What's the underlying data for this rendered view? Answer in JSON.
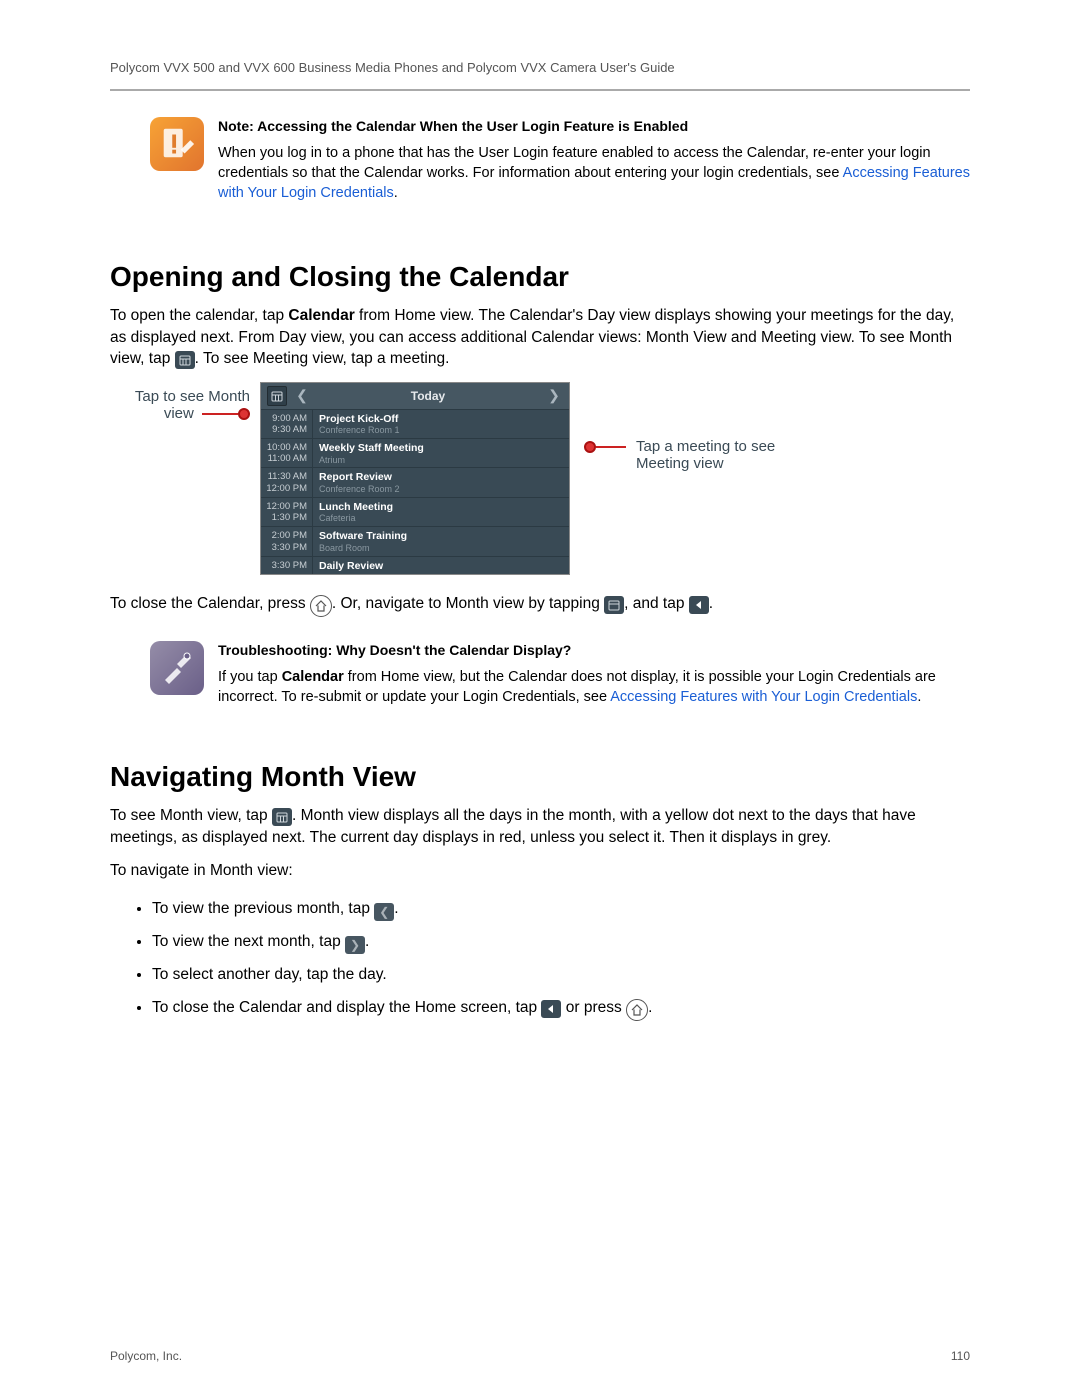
{
  "header": {
    "title": "Polycom VVX 500 and VVX 600 Business Media Phones and Polycom VVX Camera User's Guide"
  },
  "note": {
    "title": "Note: Accessing the Calendar When the User Login Feature is Enabled",
    "body_pre": "When you log in to a phone that has the User Login feature enabled to access the Calendar, re-enter your login credentials so that the Calendar works. For information about entering your login credentials, see ",
    "link": "Accessing Features with Your Login Credentials",
    "body_post": "."
  },
  "section1": {
    "heading": "Opening and Closing the Calendar",
    "p1_pre": "To open the calendar, tap ",
    "p1_bold": "Calendar",
    "p1_mid": " from Home view. The Calendar's Day view displays showing your meetings for the day, as displayed next. From Day view, you can access additional Calendar views: Month View and Meeting view. To see Month view, tap ",
    "p1_post": ". To see Meeting view, tap a meeting.",
    "close_pre": "To close the Calendar, press ",
    "close_mid": ". Or, navigate to Month view by tapping ",
    "close_between": ", and tap ",
    "close_post": "."
  },
  "callouts": {
    "left": "Tap to see Month view",
    "right": "Tap a meeting to see Meeting view"
  },
  "shot": {
    "today": "Today",
    "events": [
      {
        "start": "9:00 AM",
        "end": "9:30 AM",
        "title": "Project Kick-Off",
        "loc": "Conference Room 1"
      },
      {
        "start": "10:00 AM",
        "end": "11:00 AM",
        "title": "Weekly Staff Meeting",
        "loc": "Atrium"
      },
      {
        "start": "11:30 AM",
        "end": "12:00 PM",
        "title": "Report Review",
        "loc": "Conference Room 2"
      },
      {
        "start": "12:00 PM",
        "end": "1:30 PM",
        "title": "Lunch Meeting",
        "loc": "Cafeteria"
      },
      {
        "start": "2:00 PM",
        "end": "3:30 PM",
        "title": "Software Training",
        "loc": "Board Room"
      },
      {
        "start": "3:30 PM",
        "end": "",
        "title": "Daily Review",
        "loc": ""
      }
    ]
  },
  "trouble": {
    "title": "Troubleshooting: Why Doesn't the Calendar Display?",
    "pre": "If you tap ",
    "bold": "Calendar",
    "mid": " from Home view, but the Calendar does not display,  it is possible your Login Credentials are incorrect. To re-submit or update your Login Credentials, see ",
    "link": "Accessing Features with Your Login Credentials",
    "post": "."
  },
  "section2": {
    "heading": "Navigating Month View",
    "p1_pre": "To see Month view, tap ",
    "p1_post": ". Month view displays all the days in the month, with a yellow dot next to the days that have meetings, as displayed next. The current day displays in red, unless you select it. Then it displays in grey.",
    "nav_intro": "To navigate in Month view:",
    "li1_pre": "To view the previous month, tap ",
    "li1_post": ".",
    "li2_pre": "To view the next month, tap ",
    "li2_post": ".",
    "li3": "To select another day, tap the day.",
    "li4_pre": "To close the Calendar and display the Home screen, tap ",
    "li4_mid": " or press ",
    "li4_post": "."
  },
  "footer": {
    "left": "Polycom, Inc.",
    "right": "110"
  }
}
